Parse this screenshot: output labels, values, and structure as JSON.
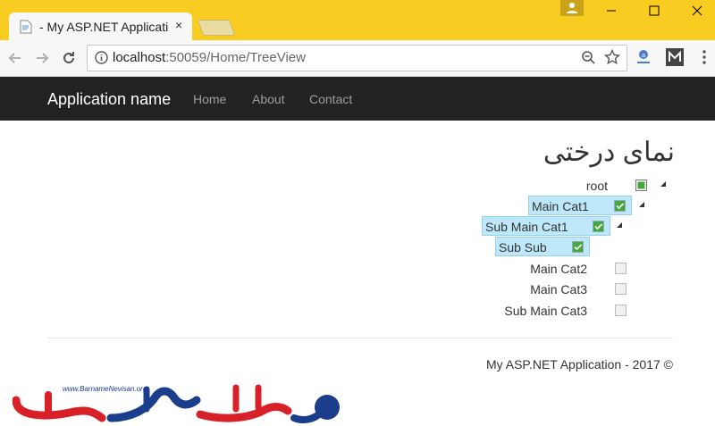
{
  "browser": {
    "tab_title": "- My ASP.NET Application",
    "tab_close": "×",
    "url_host": "localhost",
    "url_rest": ":50059/Home/TreeView"
  },
  "navbar": {
    "brand": "Application name",
    "links": [
      "Home",
      "About",
      "Contact"
    ]
  },
  "page": {
    "title": "نمای درختی"
  },
  "tree": [
    {
      "label": "root",
      "checked": "partial",
      "selected": false,
      "expanded": true
    },
    {
      "label": "Main Cat1",
      "checked": "on",
      "selected": true,
      "expanded": true
    },
    {
      "label": "Sub Main Cat1",
      "checked": "on",
      "selected": true,
      "expanded": true
    },
    {
      "label": "Sub Sub",
      "checked": "on",
      "selected": true,
      "expanded": false
    },
    {
      "label": "Main Cat2",
      "checked": "off",
      "selected": false,
      "expanded": false
    },
    {
      "label": "Main Cat3",
      "checked": "off",
      "selected": false,
      "expanded": false
    },
    {
      "label": "Sub Main Cat3",
      "checked": "off",
      "selected": false,
      "expanded": false
    }
  ],
  "footer": {
    "text": "My ASP.NET Application - 2017 ©"
  },
  "logo": {
    "url_text": "www.BarnameNevisan.org"
  },
  "colors": {
    "tabstrip": "#f9cc21",
    "navbar": "#222222",
    "selection": "#bfe7fa",
    "check_green": "#3fa93a",
    "logo_blue": "#1a3e8c",
    "logo_red": "#d72027"
  }
}
